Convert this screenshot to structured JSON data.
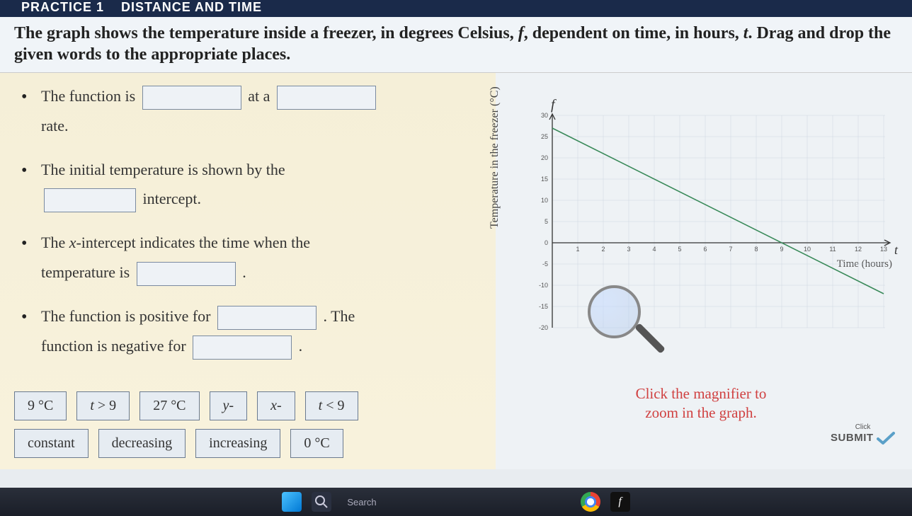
{
  "header": {
    "title_fragment": "DISTANCE AND TIME",
    "prefix": "PRACTICE 1"
  },
  "question": {
    "line": "The graph shows the temperature inside a freezer, in degrees Celsius, f, dependent on time, in hours, t. Drag and drop the given words to the appropriate places."
  },
  "statements": {
    "s1_a": "The function is",
    "s1_b": "at a",
    "s1_c": "rate.",
    "s2_a": "The initial temperature is shown by the",
    "s2_b": "intercept.",
    "s3_a": "The ",
    "s3_xint": "x",
    "s3_a2": "-intercept indicates the time when the temperature is",
    "s3_b": ".",
    "s4_a": "The function is positive for",
    "s4_b": ". The function is negative for",
    "s4_c": "."
  },
  "chips": {
    "c1": "9 °C",
    "c2": "t > 9",
    "c3": "27 °C",
    "c4": "y-",
    "c5": "x-",
    "c6": "t < 9",
    "c7": "constant",
    "c8": "decreasing",
    "c9": "increasing",
    "c10": "0 °C"
  },
  "chart_data": {
    "type": "line",
    "title": "",
    "xlabel": "Time (hours)",
    "ylabel": "Temperature in the freezer (°C)",
    "f_symbol": "f",
    "t_symbol": "t",
    "x_ticks": [
      0,
      1,
      2,
      3,
      4,
      5,
      6,
      7,
      8,
      9,
      10,
      11,
      12,
      13
    ],
    "y_ticks": [
      -20,
      -15,
      -10,
      -5,
      0,
      5,
      10,
      15,
      20,
      25,
      30
    ],
    "xlim": [
      0,
      13
    ],
    "ylim": [
      -20,
      30
    ],
    "series": [
      {
        "name": "Temperature",
        "x": [
          0,
          13
        ],
        "y": [
          27,
          -12
        ],
        "color": "#3a8a5a"
      }
    ],
    "y_intercept": 27,
    "x_intercept": 9,
    "slope": -3
  },
  "magnifier_hint": {
    "line1": "Click the magnifier to",
    "line2": "zoom in the graph."
  },
  "submit": {
    "small": "Click",
    "label": "SUBMIT"
  },
  "taskbar": {
    "search_placeholder": "Search"
  }
}
